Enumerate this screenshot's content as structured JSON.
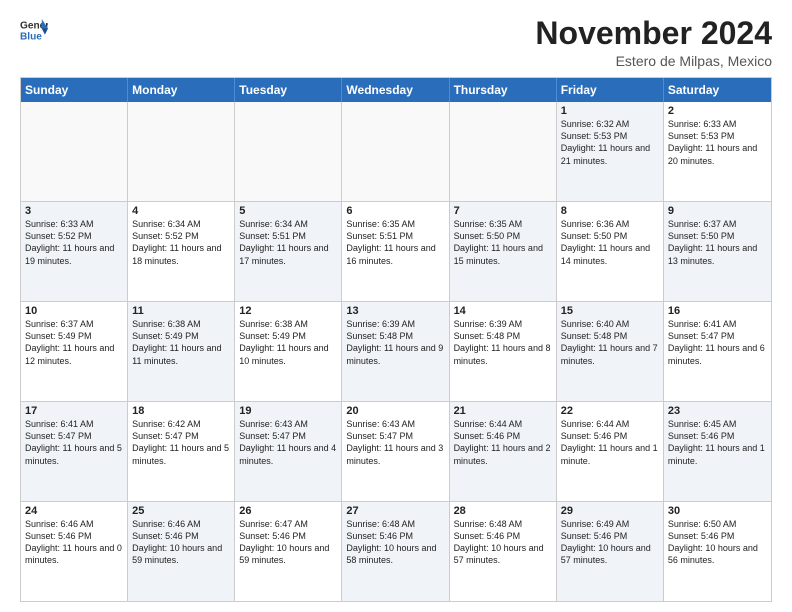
{
  "logo": {
    "general": "General",
    "blue": "Blue"
  },
  "title": "November 2024",
  "location": "Estero de Milpas, Mexico",
  "header_days": [
    "Sunday",
    "Monday",
    "Tuesday",
    "Wednesday",
    "Thursday",
    "Friday",
    "Saturday"
  ],
  "rows": [
    [
      {
        "day": "",
        "text": "",
        "empty": true
      },
      {
        "day": "",
        "text": "",
        "empty": true
      },
      {
        "day": "",
        "text": "",
        "empty": true
      },
      {
        "day": "",
        "text": "",
        "empty": true
      },
      {
        "day": "",
        "text": "",
        "empty": true
      },
      {
        "day": "1",
        "text": "Sunrise: 6:32 AM\nSunset: 5:53 PM\nDaylight: 11 hours and 21 minutes.",
        "shaded": true
      },
      {
        "day": "2",
        "text": "Sunrise: 6:33 AM\nSunset: 5:53 PM\nDaylight: 11 hours and 20 minutes.",
        "shaded": false
      }
    ],
    [
      {
        "day": "3",
        "text": "Sunrise: 6:33 AM\nSunset: 5:52 PM\nDaylight: 11 hours and 19 minutes.",
        "shaded": true
      },
      {
        "day": "4",
        "text": "Sunrise: 6:34 AM\nSunset: 5:52 PM\nDaylight: 11 hours and 18 minutes.",
        "shaded": false
      },
      {
        "day": "5",
        "text": "Sunrise: 6:34 AM\nSunset: 5:51 PM\nDaylight: 11 hours and 17 minutes.",
        "shaded": true
      },
      {
        "day": "6",
        "text": "Sunrise: 6:35 AM\nSunset: 5:51 PM\nDaylight: 11 hours and 16 minutes.",
        "shaded": false
      },
      {
        "day": "7",
        "text": "Sunrise: 6:35 AM\nSunset: 5:50 PM\nDaylight: 11 hours and 15 minutes.",
        "shaded": true
      },
      {
        "day": "8",
        "text": "Sunrise: 6:36 AM\nSunset: 5:50 PM\nDaylight: 11 hours and 14 minutes.",
        "shaded": false
      },
      {
        "day": "9",
        "text": "Sunrise: 6:37 AM\nSunset: 5:50 PM\nDaylight: 11 hours and 13 minutes.",
        "shaded": true
      }
    ],
    [
      {
        "day": "10",
        "text": "Sunrise: 6:37 AM\nSunset: 5:49 PM\nDaylight: 11 hours and 12 minutes.",
        "shaded": false
      },
      {
        "day": "11",
        "text": "Sunrise: 6:38 AM\nSunset: 5:49 PM\nDaylight: 11 hours and 11 minutes.",
        "shaded": true
      },
      {
        "day": "12",
        "text": "Sunrise: 6:38 AM\nSunset: 5:49 PM\nDaylight: 11 hours and 10 minutes.",
        "shaded": false
      },
      {
        "day": "13",
        "text": "Sunrise: 6:39 AM\nSunset: 5:48 PM\nDaylight: 11 hours and 9 minutes.",
        "shaded": true
      },
      {
        "day": "14",
        "text": "Sunrise: 6:39 AM\nSunset: 5:48 PM\nDaylight: 11 hours and 8 minutes.",
        "shaded": false
      },
      {
        "day": "15",
        "text": "Sunrise: 6:40 AM\nSunset: 5:48 PM\nDaylight: 11 hours and 7 minutes.",
        "shaded": true
      },
      {
        "day": "16",
        "text": "Sunrise: 6:41 AM\nSunset: 5:47 PM\nDaylight: 11 hours and 6 minutes.",
        "shaded": false
      }
    ],
    [
      {
        "day": "17",
        "text": "Sunrise: 6:41 AM\nSunset: 5:47 PM\nDaylight: 11 hours and 5 minutes.",
        "shaded": true
      },
      {
        "day": "18",
        "text": "Sunrise: 6:42 AM\nSunset: 5:47 PM\nDaylight: 11 hours and 5 minutes.",
        "shaded": false
      },
      {
        "day": "19",
        "text": "Sunrise: 6:43 AM\nSunset: 5:47 PM\nDaylight: 11 hours and 4 minutes.",
        "shaded": true
      },
      {
        "day": "20",
        "text": "Sunrise: 6:43 AM\nSunset: 5:47 PM\nDaylight: 11 hours and 3 minutes.",
        "shaded": false
      },
      {
        "day": "21",
        "text": "Sunrise: 6:44 AM\nSunset: 5:46 PM\nDaylight: 11 hours and 2 minutes.",
        "shaded": true
      },
      {
        "day": "22",
        "text": "Sunrise: 6:44 AM\nSunset: 5:46 PM\nDaylight: 11 hours and 1 minute.",
        "shaded": false
      },
      {
        "day": "23",
        "text": "Sunrise: 6:45 AM\nSunset: 5:46 PM\nDaylight: 11 hours and 1 minute.",
        "shaded": true
      }
    ],
    [
      {
        "day": "24",
        "text": "Sunrise: 6:46 AM\nSunset: 5:46 PM\nDaylight: 11 hours and 0 minutes.",
        "shaded": false
      },
      {
        "day": "25",
        "text": "Sunrise: 6:46 AM\nSunset: 5:46 PM\nDaylight: 10 hours and 59 minutes.",
        "shaded": true
      },
      {
        "day": "26",
        "text": "Sunrise: 6:47 AM\nSunset: 5:46 PM\nDaylight: 10 hours and 59 minutes.",
        "shaded": false
      },
      {
        "day": "27",
        "text": "Sunrise: 6:48 AM\nSunset: 5:46 PM\nDaylight: 10 hours and 58 minutes.",
        "shaded": true
      },
      {
        "day": "28",
        "text": "Sunrise: 6:48 AM\nSunset: 5:46 PM\nDaylight: 10 hours and 57 minutes.",
        "shaded": false
      },
      {
        "day": "29",
        "text": "Sunrise: 6:49 AM\nSunset: 5:46 PM\nDaylight: 10 hours and 57 minutes.",
        "shaded": true
      },
      {
        "day": "30",
        "text": "Sunrise: 6:50 AM\nSunset: 5:46 PM\nDaylight: 10 hours and 56 minutes.",
        "shaded": false
      }
    ]
  ]
}
